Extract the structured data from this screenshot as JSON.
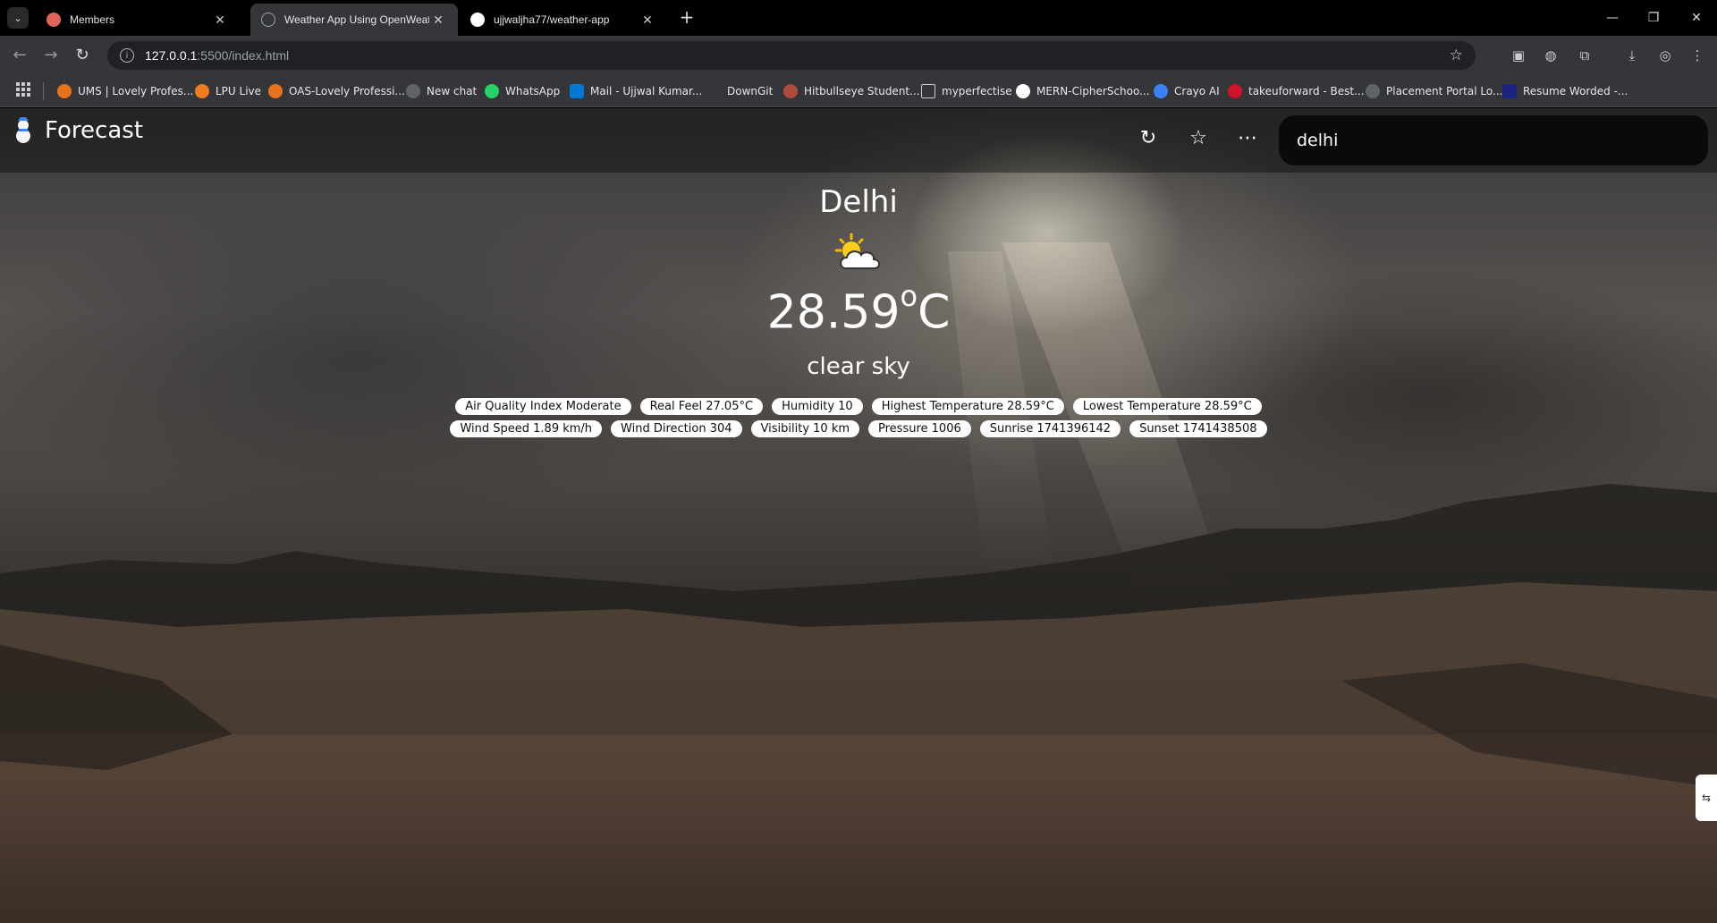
{
  "browser": {
    "tabs": [
      {
        "title": "Members",
        "icon": "hand-icon",
        "color": "#e0665a"
      },
      {
        "title": "Weather App Using OpenWeatl",
        "icon": "globe-icon",
        "color": "#9aa0a6"
      },
      {
        "title": "ujjwaljha77/weather-app",
        "icon": "github-icon",
        "color": "#ffffff"
      }
    ],
    "url_host": "127.0.0.1",
    "url_path": ":5500/index.html",
    "bookmarks": [
      {
        "label": "UMS | Lovely Profes...",
        "color": "#e8731a"
      },
      {
        "label": "LPU Live",
        "color": "#f07d1f"
      },
      {
        "label": "OAS-Lovely Professi...",
        "color": "#e8731a"
      },
      {
        "label": "New chat",
        "color": "#5f6368"
      },
      {
        "label": "WhatsApp",
        "color": "#25d366"
      },
      {
        "label": "Mail - Ujjwal Kumar...",
        "color": "#0078d4"
      },
      {
        "label": "DownGit",
        "color": "#35363a"
      },
      {
        "label": "Hitbullseye Student...",
        "color": "#b04a3c"
      },
      {
        "label": "myperfectise",
        "color": "#35363a"
      },
      {
        "label": "MERN-CipherSchoo...",
        "color": "#35363a"
      },
      {
        "label": "Crayo AI",
        "color": "#3b82f6"
      },
      {
        "label": "takeuforward - Best...",
        "color": "#d0122a"
      },
      {
        "label": "Placement Portal Lo...",
        "color": "#5f6368"
      },
      {
        "label": "Resume Worded -...",
        "color": "#1a237e"
      }
    ]
  },
  "app": {
    "brand": "Forecast",
    "search_value": "delhi"
  },
  "weather": {
    "city": "Delhi",
    "temp": "28.59",
    "temp_unit_sup": "o",
    "temp_unit": "C",
    "description": "clear sky",
    "details": [
      "Air Quality Index Moderate",
      "Real Feel 27.05°C",
      "Humidity 10",
      "Highest Temperature 28.59°C",
      "Lowest Temperature 28.59°C",
      "Wind Speed 1.89 km/h",
      "Wind Direction 304",
      "Visibility 10 km",
      "Pressure 1006",
      "Sunrise 1741396142",
      "Sunset 1741438508"
    ]
  }
}
